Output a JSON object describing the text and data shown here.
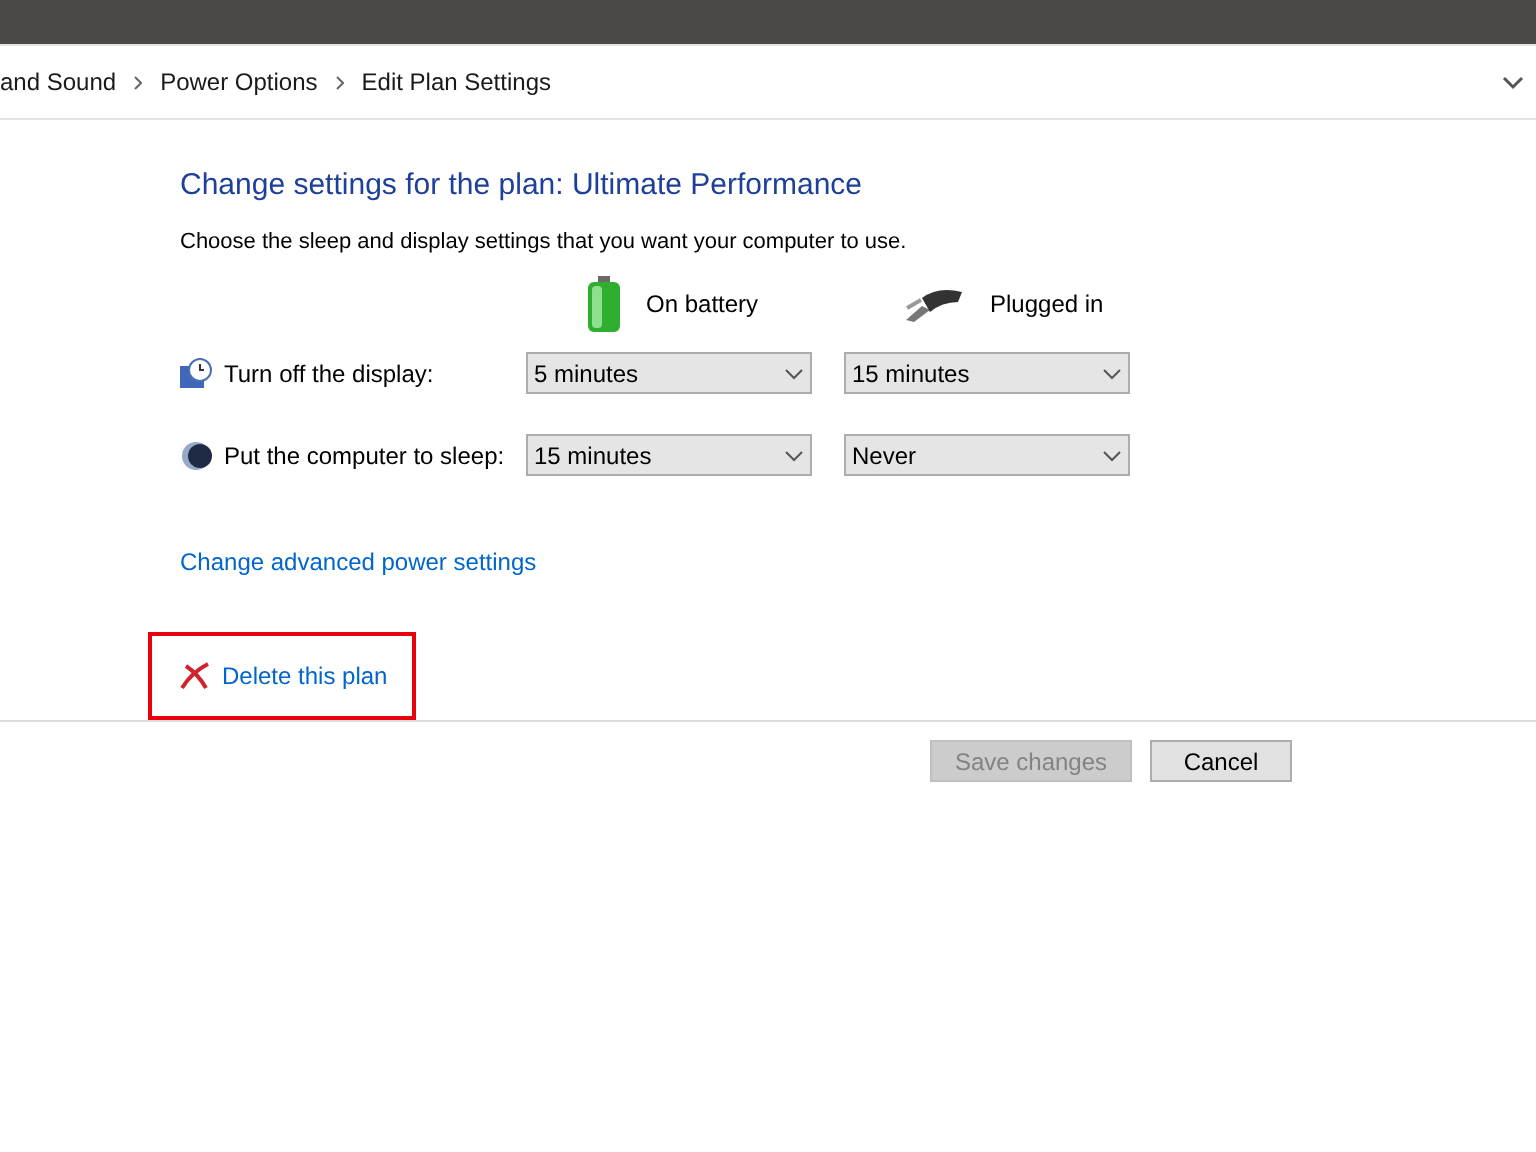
{
  "breadcrumb": [
    "and Sound",
    "Power Options",
    "Edit Plan Settings"
  ],
  "title": "Change settings for the plan: Ultimate Performance",
  "subtitle": "Choose the sleep and display settings that you want your computer to use.",
  "columns": [
    {
      "label": "On battery",
      "kind": "battery"
    },
    {
      "label": "Plugged in",
      "kind": "plug"
    }
  ],
  "settings": [
    {
      "label": "Turn off the display:",
      "kind": "display",
      "values": [
        "5 minutes",
        "15 minutes"
      ]
    },
    {
      "label": "Put the computer to sleep:",
      "kind": "sleep",
      "values": [
        "15 minutes",
        "Never"
      ]
    }
  ],
  "advanced_link": "Change advanced power settings",
  "delete_link": {
    "label": "Delete this plan",
    "highlighted": true
  },
  "buttons": [
    {
      "label": "Save changes",
      "disabled": true
    },
    {
      "label": "Cancel",
      "disabled": false
    }
  ]
}
